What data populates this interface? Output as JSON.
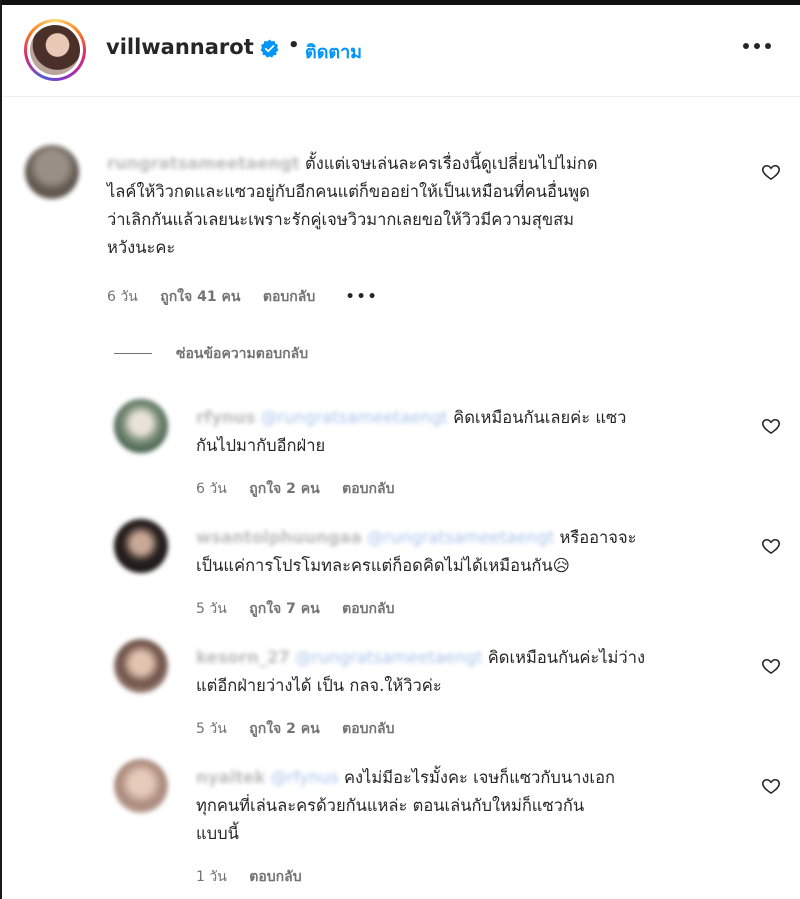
{
  "header": {
    "username": "villwannarot",
    "separator": "•",
    "follow_label": "ติดตาม"
  },
  "main_comment": {
    "username": "rungratsameetaengt",
    "text_lines": [
      "ตั้งแต่เจษเล่นละครเรื่องนี้ดูเปลี่ยนไปไม่กด",
      "ไลค์ให้วิวกดและแซวอยู่กับอีกคนแต่ก็ขออย่าให้เป็นเหมือนที่คนอื่นพูด",
      "ว่าเลิกกันแล้วเลยนะเพราะรักคู่เจษวิวมากเลยขอให้วิวมีความสุขสม",
      "หวังนะคะ"
    ],
    "time": "6 วัน",
    "likes": "ถูกใจ 41 คน",
    "reply_label": "ตอบกลับ",
    "more": "•••"
  },
  "hide_replies_label": "ซ่อนข้อความตอบกลับ",
  "replies": [
    {
      "username": "rfynus",
      "mention": "@rungratsameetaengt",
      "line1": "คิดเหมือนกันเลยค่ะ แซว",
      "line2": "กันไปมากับอีกฝ่าย",
      "time": "6 วัน",
      "likes": "ถูกใจ 2 คน",
      "reply_label": "ตอบกลับ"
    },
    {
      "username": "wsantolphuungaa",
      "mention": "@rungratsameetaengt",
      "line1": "หรืออาจจะ",
      "line2": "เป็นแค่การโปรโมทละครแต่ก็อดคิดไม่ได้เหมือนกัน😥",
      "time": "5 วัน",
      "likes": "ถูกใจ 7 คน",
      "reply_label": "ตอบกลับ"
    },
    {
      "username": "kesorn_27",
      "mention": "@rungratsameetaengt",
      "line1": "คิดเหมือนกันค่ะไม่ว่าง",
      "line2": "แต่อีกฝ่ายว่างได้ เป็น กลจ.ให้วิวค่ะ",
      "time": "5 วัน",
      "likes": "ถูกใจ 2 คน",
      "reply_label": "ตอบกลับ"
    },
    {
      "username": "nyaitek",
      "mention": "@rfynus",
      "line1": "คงไม่มีอะไรมั้งคะ เจษก็แซวกับนางเอก",
      "line2": "ทุกคนที่เล่นละครด้วยกันแหล่ะ ตอนเล่นกับใหม่ก็แซวกัน",
      "line3": "แบบนี้",
      "time": "1 วัน",
      "reply_label": "ตอบกลับ"
    }
  ],
  "colors": {
    "link_blue": "#0095f6",
    "text": "#262626",
    "meta_gray": "#737373"
  },
  "icons": [
    "verified-badge-icon",
    "more-options-icon",
    "heart-icon"
  ]
}
